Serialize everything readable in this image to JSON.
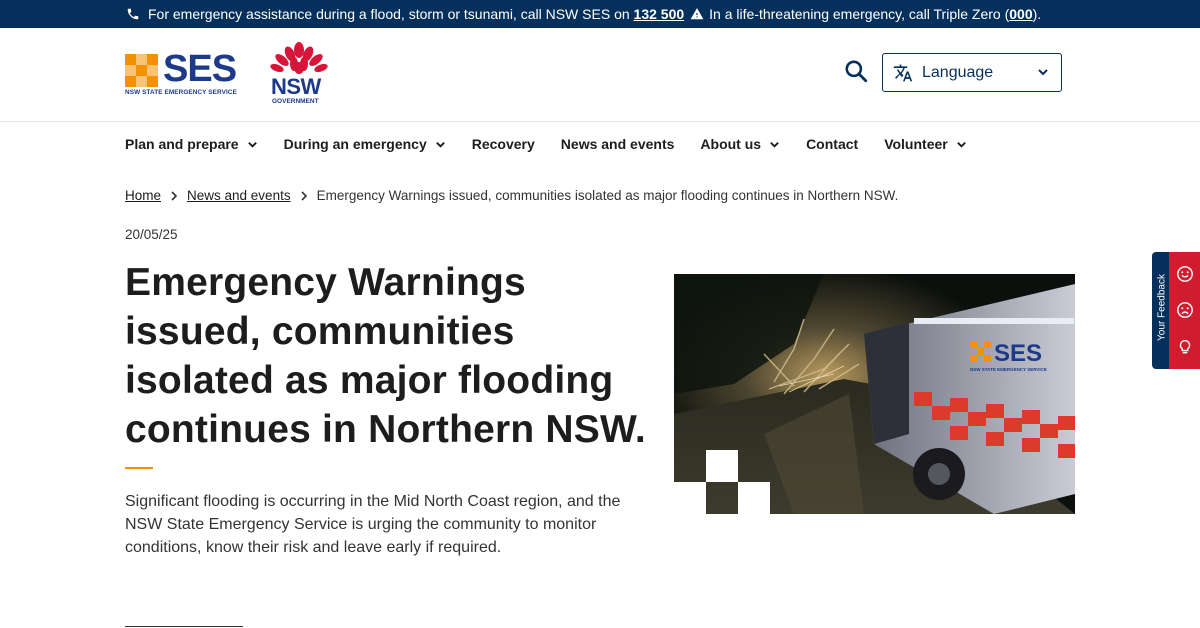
{
  "alert_bar": {
    "text_before": "For emergency assistance during a flood, storm or tsunami, call NSW SES on",
    "ses_number": "132 500",
    "text_middle": "In a life-threatening emergency, call Triple Zero (",
    "triple_zero": "000",
    "text_after": ")."
  },
  "logos": {
    "ses_word": "SES",
    "ses_subtitle": "NSW STATE EMERGENCY SERVICE",
    "nsw_word": "NSW",
    "nsw_subtitle": "GOVERNMENT"
  },
  "header": {
    "search_icon": "search-icon",
    "language_label": "Language"
  },
  "nav": {
    "items": [
      {
        "label": "Plan and prepare",
        "has_dropdown": true
      },
      {
        "label": "During an emergency",
        "has_dropdown": true
      },
      {
        "label": "Recovery",
        "has_dropdown": false
      },
      {
        "label": "News and events",
        "has_dropdown": false
      },
      {
        "label": "About us",
        "has_dropdown": true
      },
      {
        "label": "Contact",
        "has_dropdown": false
      },
      {
        "label": "Volunteer",
        "has_dropdown": true
      }
    ]
  },
  "breadcrumb": {
    "home": "Home",
    "news": "News and events",
    "current": "Emergency Warnings issued, communities isolated as major flooding continues in Northern NSW."
  },
  "article": {
    "date": "20/05/25",
    "title": "Emergency Warnings issued, communities isolated as major flooding continues in Northern NSW.",
    "lede": "Significant flooding is occurring in the Mid North Coast region, and the NSW State Emergency Service is urging the community to monitor conditions, know their risk and leave early if required."
  },
  "hero_image": {
    "vehicle_text": "SES",
    "vehicle_subtext": "NSW STATE EMERGENCY SERVICE"
  },
  "feedback": {
    "label": "Your Feedback"
  },
  "colors": {
    "navy": "#06305c",
    "accent_orange": "#f39200",
    "feedback_red": "#d11b2f",
    "ses_blue": "#1d3a8a"
  }
}
